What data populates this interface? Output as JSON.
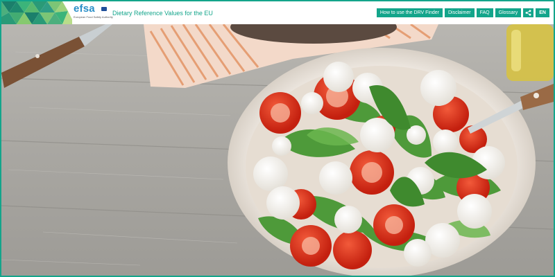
{
  "brand": {
    "logo_text": "efsa",
    "logo_subtitle": "European Food Safety Authority",
    "site_title": "Dietary Reference Values for the EU"
  },
  "nav": {
    "how_to": "How to use the DRV Finder",
    "disclaimer": "Disclaimer",
    "faq": "FAQ",
    "glossary": "Glossary",
    "share_icon": "share-icon",
    "language": "EN"
  },
  "colors": {
    "accent": "#13a58b",
    "logo_blue": "#2a8fc8"
  },
  "hero": {
    "description_icon": "salad-photo"
  }
}
